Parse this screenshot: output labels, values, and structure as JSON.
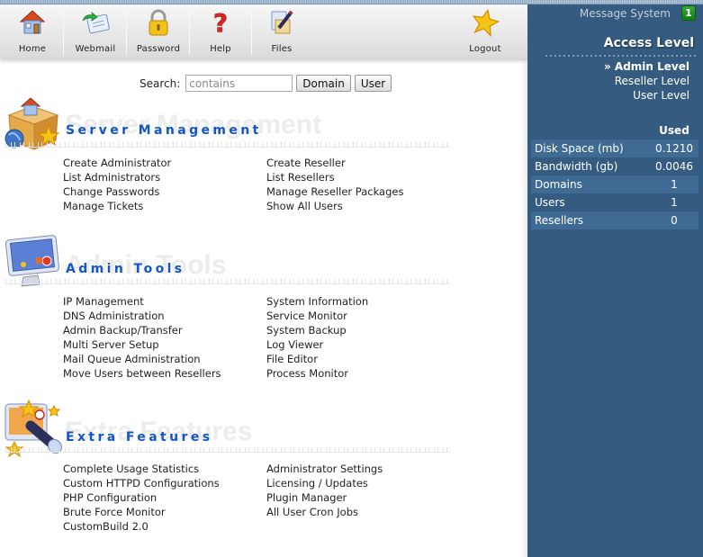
{
  "toolbar": {
    "items": [
      {
        "label": "Home",
        "icon": "home-icon"
      },
      {
        "label": "Webmail",
        "icon": "mail-icon"
      },
      {
        "label": "Password",
        "icon": "padlock-icon"
      },
      {
        "label": "Help",
        "icon": "question-mark-icon"
      },
      {
        "label": "Files",
        "icon": "files-icon"
      },
      {
        "label": "Logout",
        "icon": "star-icon"
      }
    ]
  },
  "search": {
    "label": "Search:",
    "value": "contains",
    "domain_button": "Domain",
    "user_button": "User"
  },
  "sidebar": {
    "message_system": "Message System",
    "message_count": "1",
    "access_title": "Access Level",
    "levels": [
      {
        "label": "» Admin Level",
        "active": true
      },
      {
        "label": "Reseller Level",
        "active": false
      },
      {
        "label": "User Level",
        "active": false
      }
    ],
    "usage": {
      "header": "Used",
      "rows": [
        {
          "label": "Disk Space (mb)",
          "value": "0.1210"
        },
        {
          "label": "Bandwidth (gb)",
          "value": "0.0046"
        },
        {
          "label": "Domains",
          "value": "1"
        },
        {
          "label": "Users",
          "value": "1"
        },
        {
          "label": "Resellers",
          "value": "0"
        }
      ]
    },
    "colors": {
      "background": "#355c80",
      "row_alt": "#3f6a93",
      "badge": "#1f8f1f"
    }
  },
  "sections": [
    {
      "title": "Server Management",
      "icon": "server-management-box-icon",
      "col1": [
        "Create Administrator",
        "List Administrators",
        "Change Passwords",
        "Manage Tickets"
      ],
      "col2": [
        "Create Reseller",
        "List Resellers",
        "Manage Reseller Packages",
        "Show All Users"
      ]
    },
    {
      "title": "Admin Tools",
      "icon": "monitor-icon",
      "col1": [
        "IP Management",
        "DNS Administration",
        "Admin Backup/Transfer",
        "Multi Server Setup",
        "Mail Queue Administration",
        "Move Users between Resellers"
      ],
      "col2": [
        "System Information",
        "Service Monitor",
        "System Backup",
        "Log Viewer",
        "File Editor",
        "Process Monitor"
      ]
    },
    {
      "title": "Extra Features",
      "icon": "monitor-telescope-icon",
      "col1": [
        "Complete Usage Statistics",
        "Custom HTTPD Configurations",
        "PHP Configuration",
        "Brute Force Monitor",
        "CustomBuild 2.0"
      ],
      "col2": [
        "Administrator Settings",
        "Licensing / Updates",
        "Plugin Manager",
        "All User Cron Jobs"
      ]
    }
  ],
  "colors": {
    "section_title": "#1456c8",
    "link_text": "#222222"
  }
}
